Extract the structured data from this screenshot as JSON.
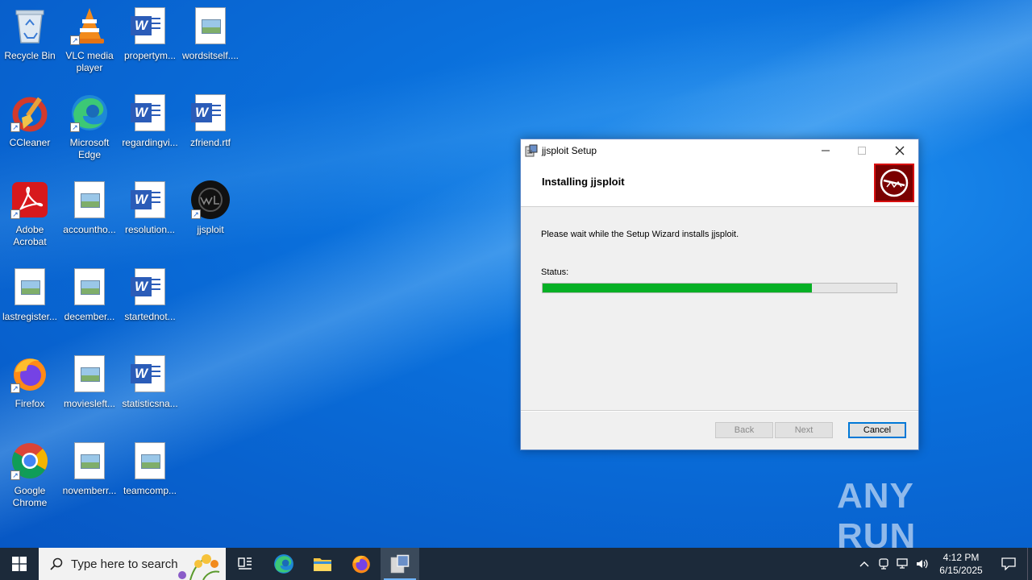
{
  "desktop": {
    "icons": [
      {
        "label": "Recycle Bin",
        "icon": "recycle-bin-icon"
      },
      {
        "label": "VLC media player",
        "icon": "vlc-icon"
      },
      {
        "label": "propertym...",
        "icon": "word-doc-icon"
      },
      {
        "label": "wordsitself....",
        "icon": "image-doc-icon"
      },
      {
        "label": "CCleaner",
        "icon": "ccleaner-icon"
      },
      {
        "label": "Microsoft Edge",
        "icon": "edge-icon"
      },
      {
        "label": "regardingvi...",
        "icon": "word-doc-icon"
      },
      {
        "label": "zfriend.rtf",
        "icon": "word-doc-icon"
      },
      {
        "label": "Adobe Acrobat",
        "icon": "acrobat-icon"
      },
      {
        "label": "accountho...",
        "icon": "image-doc-icon"
      },
      {
        "label": "resolution...",
        "icon": "word-doc-icon"
      },
      {
        "label": "jjsploit",
        "icon": "jjsploit-icon"
      },
      {
        "label": "lastregister...",
        "icon": "image-doc-icon"
      },
      {
        "label": "december...",
        "icon": "image-doc-icon"
      },
      {
        "label": "startednot...",
        "icon": "word-doc-icon"
      },
      {
        "label": "Firefox",
        "icon": "firefox-icon"
      },
      {
        "label": "moviesleft...",
        "icon": "image-doc-icon"
      },
      {
        "label": "statisticsna...",
        "icon": "word-doc-icon"
      },
      {
        "label": "Google Chrome",
        "icon": "chrome-icon"
      },
      {
        "label": "novemberr...",
        "icon": "image-doc-icon"
      },
      {
        "label": "teamcomp...",
        "icon": "image-doc-icon"
      }
    ]
  },
  "installer": {
    "title": "jjsploit Setup",
    "header_title": "Installing jjsploit",
    "message": "Please wait while the Setup Wizard installs jjsploit.",
    "status_label": "Status:",
    "progress": 0.76,
    "back_label": "Back",
    "next_label": "Next",
    "cancel_label": "Cancel"
  },
  "watermark": "ANY RUN",
  "taskbar": {
    "search_placeholder": "Type here to search",
    "time": "4:12 PM",
    "date": "6/15/2025"
  },
  "colors": {
    "progress_fill": "#06b025",
    "accent": "#0078d7"
  }
}
